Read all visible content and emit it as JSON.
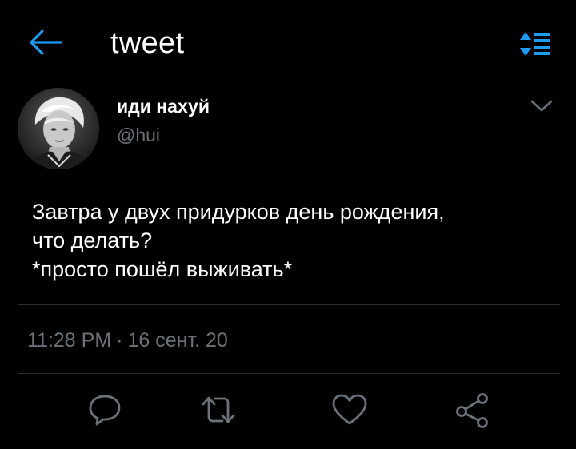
{
  "header": {
    "title": "tweet",
    "back_icon": "arrow-left-icon",
    "sort_icon": "sort-icon",
    "accent_color": "#1d9bf0"
  },
  "author": {
    "name": "иди нахуй",
    "handle": "@hui",
    "avatar_icon": "avatar-photo",
    "menu_icon": "chevron-down-icon"
  },
  "tweet": {
    "lines": [
      "Завтра у двух придурков день рождения,",
      "что делать?",
      "*просто пошёл выживать*"
    ],
    "time": "11:28 PM",
    "separator": "·",
    "date": "16 сент. 20"
  },
  "actions": {
    "reply_icon": "reply-icon",
    "retweet_icon": "retweet-icon",
    "like_icon": "heart-icon",
    "share_icon": "share-icon",
    "icon_color": "#6b7279"
  },
  "colors": {
    "background": "#000000",
    "text": "#ffffff",
    "secondary_text": "#6b7279",
    "divider": "#2a2e33"
  }
}
